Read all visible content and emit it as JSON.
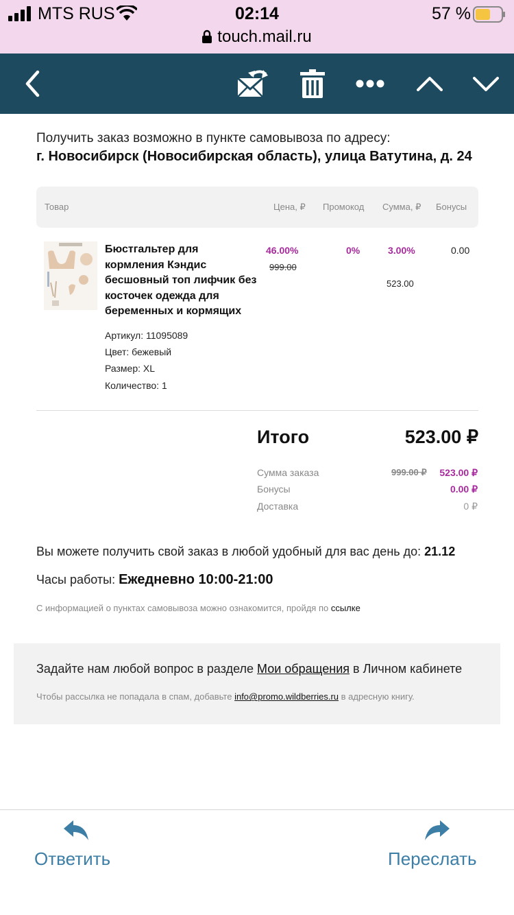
{
  "status_bar": {
    "carrier": "MTS RUS",
    "time": "02:14",
    "battery_percent": "57 %",
    "battery_level": 0.57,
    "url": "touch.mail.ru"
  },
  "toolbar": {
    "icons": [
      "back-icon",
      "mark-unread-icon",
      "trash-icon",
      "more-icon",
      "previous-icon",
      "next-icon"
    ]
  },
  "pickup": {
    "intro": "Получить заказ возможно в пункте самовывоза по адресу:",
    "address": "г. Новосибирск (Новосибирская область), улица Ватутина, д. 24"
  },
  "table": {
    "headers": {
      "product": "Товар",
      "price": "Цена, ₽",
      "promo": "Промокод",
      "sum": "Сумма, ₽",
      "bonus": "Бонусы"
    }
  },
  "product": {
    "name": "Бюстгальтер для кормления Кэндис бесшовный топ лифчик без косточек одежда для беременных и кормящих",
    "article": "Артикул: 11095089",
    "color": "Цвет: бежевый",
    "size": "Размер: XL",
    "quantity": "Количество: 1",
    "price_discount": "46.00%",
    "price_old": "999.00",
    "promo": "0%",
    "sum_discount": "3.00%",
    "sum_value": "523.00",
    "bonus": "0.00"
  },
  "totals": {
    "total_label": "Итого",
    "total_value": "523.00 ₽",
    "order_sum_label": "Сумма заказа",
    "order_sum_old": "999.00 ₽",
    "order_sum_value": "523.00 ₽",
    "bonuses_label": "Бонусы",
    "bonuses_value": "0.00 ₽",
    "delivery_label": "Доставка",
    "delivery_value": "0 ₽"
  },
  "pickup_info": {
    "deadline_text": "Вы можете получить свой заказ в любой удобный для вас день до: ",
    "deadline_date": "21.12",
    "hours_text": "Часы работы: ",
    "hours_value": "Ежедневно 10:00-21:00",
    "info_text": "С информацией о пунктах самовывоза можно ознакомится, пройдя по ",
    "info_link": "ссылке"
  },
  "footer": {
    "question_text": "Задайте нам любой вопрос в разделе ",
    "question_link": "Мои обращения",
    "question_tail": " в Личном кабинете",
    "spam_text": "Чтобы рассылка не попадала в спам, добавьте ",
    "spam_email": "info@promo.wildberries.ru",
    "spam_tail": " в адресную книгу."
  },
  "bottom_bar": {
    "reply_label": "Ответить",
    "forward_label": "Переслать"
  },
  "colors": {
    "toolbar": "#1d4a5e",
    "status_bar": "#f3d7ec",
    "accent": "#a62a9c",
    "link_blue": "#3c7ea6"
  }
}
